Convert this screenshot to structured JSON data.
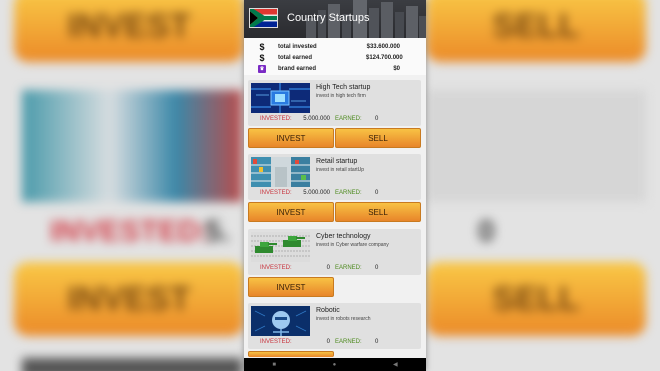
{
  "app": {
    "title": "Country Startups",
    "flag_name": "south-africa-flag"
  },
  "stats": {
    "total_invested_label": "total invested",
    "total_invested_value": "$33.600.000",
    "total_earned_label": "total earned",
    "total_earned_value": "$124.700.000",
    "brand_earned_label": "brand earned",
    "brand_earned_value": "$0"
  },
  "labels": {
    "invested": "INVESTED:",
    "earned": "EARNED:",
    "invest_btn": "INVEST",
    "sell_btn": "SELL"
  },
  "startups": [
    {
      "title": "High Tech startup",
      "description": "invest in high tech firm",
      "invested": "5.000.000",
      "earned": "0",
      "image": "circuit-board-image"
    },
    {
      "title": "Retail startup",
      "description": "invest in retail startUp",
      "invested": "5.000.000",
      "earned": "0",
      "image": "supermarket-shelves-image"
    },
    {
      "title": "Cyber technology",
      "description": "invest in Cyber warfare company",
      "invested": "0",
      "earned": "0",
      "image": "tanks-on-code-image"
    },
    {
      "title": "Robotic",
      "description": "invest in robots research",
      "invested": "0",
      "earned": "0",
      "image": "robot-face-image"
    }
  ],
  "nav": {
    "back": "◀",
    "home": "●",
    "recents": "■"
  },
  "colors": {
    "button_top": "#f8c244",
    "button_bottom": "#e8852a",
    "invested_red": "#c8323c",
    "earned_green": "#4d8a1e",
    "brand_purple": "#7a2ac4"
  }
}
